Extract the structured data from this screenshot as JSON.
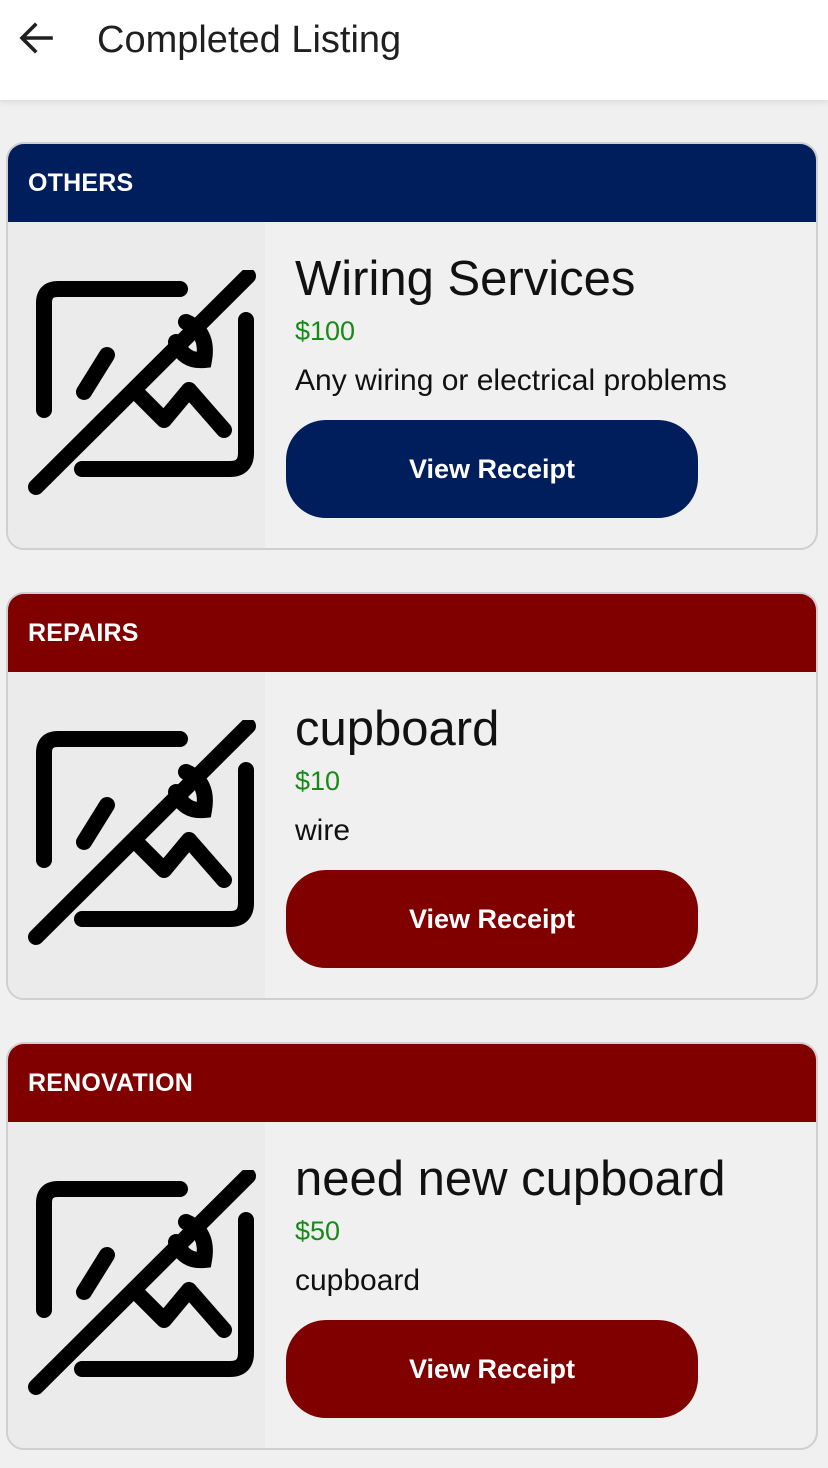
{
  "header": {
    "title": "Completed Listing",
    "back_icon": "arrow-left-icon"
  },
  "theme": {
    "navy": "#001e5b",
    "maroon": "#800000",
    "price_green": "#178a17"
  },
  "listings": [
    {
      "category": "OTHERS",
      "title": "Wiring Services",
      "price": "$100",
      "description": "Any wiring or electrical problems",
      "button_label": "View Receipt",
      "color": "#001e5b",
      "image_icon": "image-not-available-icon"
    },
    {
      "category": "REPAIRS",
      "title": "cupboard",
      "price": "$10",
      "description": "wire",
      "button_label": "View Receipt",
      "color": "#800000",
      "image_icon": "image-not-available-icon"
    },
    {
      "category": "RENOVATION",
      "title": "need new cupboard",
      "price": "$50",
      "description": "cupboard",
      "button_label": "View Receipt",
      "color": "#800000",
      "image_icon": "image-not-available-icon"
    }
  ]
}
